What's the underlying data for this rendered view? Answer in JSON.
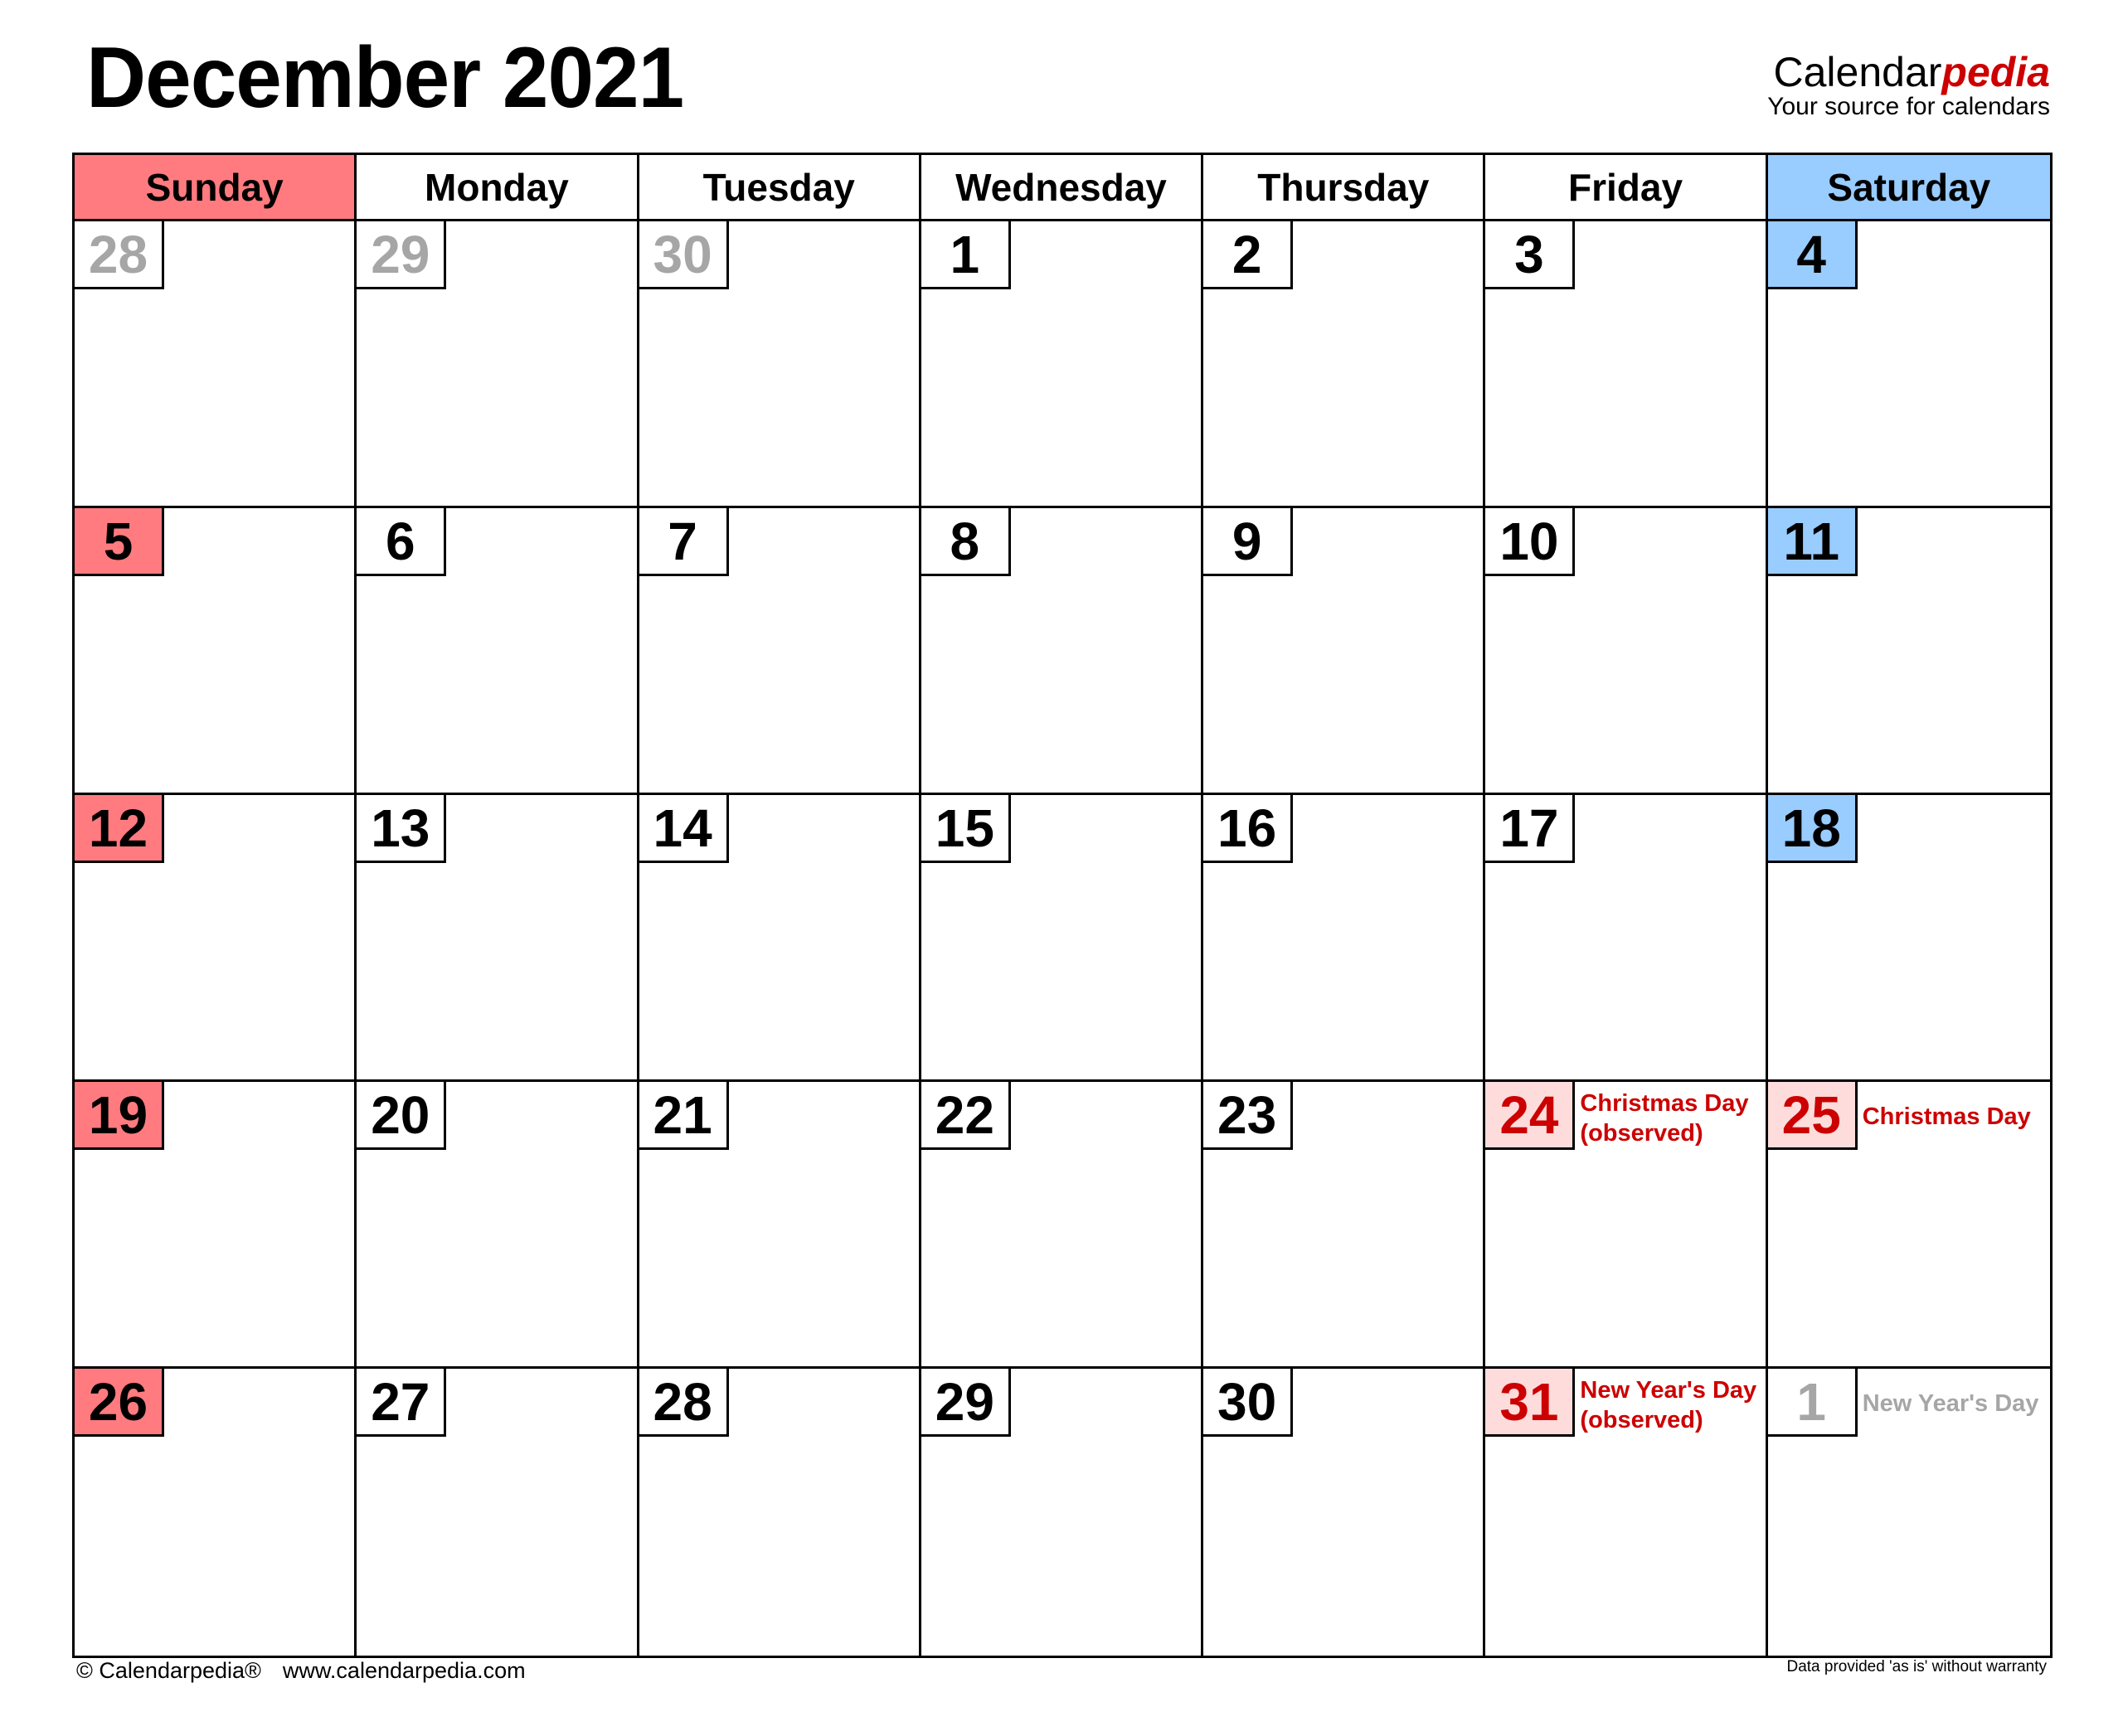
{
  "title": "December 2021",
  "brand": {
    "name_main": "Calendar",
    "name_accent": "pedia",
    "tagline": "Your source for calendars"
  },
  "colors": {
    "sunday": "#ff7b7f",
    "saturday": "#99ccff",
    "holiday_bg": "#ffdcdc",
    "holiday_text": "#cc0000",
    "other_month": "#a6a6a6"
  },
  "weekdays": [
    "Sunday",
    "Monday",
    "Tuesday",
    "Wednesday",
    "Thursday",
    "Friday",
    "Saturday"
  ],
  "weeks": [
    [
      {
        "day": "28",
        "type": "other"
      },
      {
        "day": "29",
        "type": "other"
      },
      {
        "day": "30",
        "type": "other"
      },
      {
        "day": "1",
        "type": "normal"
      },
      {
        "day": "2",
        "type": "normal"
      },
      {
        "day": "3",
        "type": "normal"
      },
      {
        "day": "4",
        "type": "sat"
      }
    ],
    [
      {
        "day": "5",
        "type": "sun"
      },
      {
        "day": "6",
        "type": "normal"
      },
      {
        "day": "7",
        "type": "normal"
      },
      {
        "day": "8",
        "type": "normal"
      },
      {
        "day": "9",
        "type": "normal"
      },
      {
        "day": "10",
        "type": "normal"
      },
      {
        "day": "11",
        "type": "sat"
      }
    ],
    [
      {
        "day": "12",
        "type": "sun"
      },
      {
        "day": "13",
        "type": "normal"
      },
      {
        "day": "14",
        "type": "normal"
      },
      {
        "day": "15",
        "type": "normal"
      },
      {
        "day": "16",
        "type": "normal"
      },
      {
        "day": "17",
        "type": "normal"
      },
      {
        "day": "18",
        "type": "sat"
      }
    ],
    [
      {
        "day": "19",
        "type": "sun"
      },
      {
        "day": "20",
        "type": "normal"
      },
      {
        "day": "21",
        "type": "normal"
      },
      {
        "day": "22",
        "type": "normal"
      },
      {
        "day": "23",
        "type": "normal"
      },
      {
        "day": "24",
        "type": "hol",
        "holiday": [
          "Christmas Day",
          "(observed)"
        ]
      },
      {
        "day": "25",
        "type": "hol",
        "holiday": [
          "Christmas Day"
        ]
      }
    ],
    [
      {
        "day": "26",
        "type": "sun"
      },
      {
        "day": "27",
        "type": "normal"
      },
      {
        "day": "28",
        "type": "normal"
      },
      {
        "day": "29",
        "type": "normal"
      },
      {
        "day": "30",
        "type": "normal"
      },
      {
        "day": "31",
        "type": "hol",
        "holiday": [
          "New Year's Day",
          "(observed)"
        ]
      },
      {
        "day": "1",
        "type": "other",
        "holiday": [
          "New Year's Day"
        ]
      }
    ]
  ],
  "footer": {
    "copyright": "© Calendarpedia®",
    "url": "www.calendarpedia.com",
    "disclaimer": "Data provided 'as is' without warranty"
  }
}
